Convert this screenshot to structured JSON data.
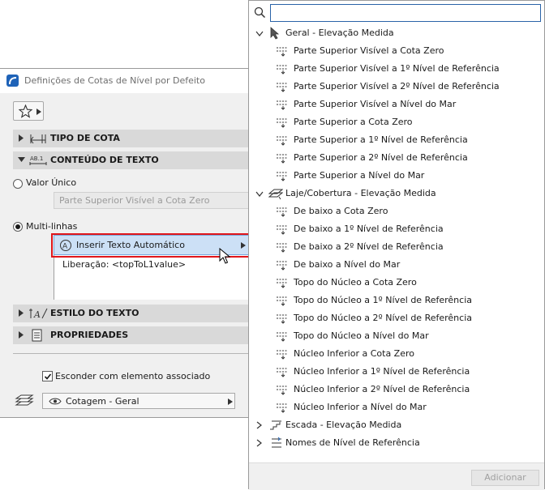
{
  "dialog": {
    "title": "Definições de Cotas de Nível por Defeito",
    "sections": {
      "tipo_de_cota": "TIPO DE COTA",
      "conteudo_de_texto": "CONTEÚDO DE TEXTO",
      "estilo_do_texto": "ESTILO DO TEXTO",
      "propriedades": "PROPRIEDADES"
    },
    "valor_unico_label": "Valor Único",
    "valor_unico_value": "Parte Superior Visível a Cota Zero",
    "multi_linhas_label": "Multi-linhas",
    "auto_text_button": "Inserir Texto Automático",
    "multi_text_content": "Liberação: <topToL1value>",
    "hide_checkbox_label": "Esconder com elemento associado",
    "hide_checked": true,
    "layer_value": "Cotagem - Geral"
  },
  "popup": {
    "search_value": "",
    "groups": [
      {
        "label": "Geral - Elevação Medida",
        "expanded": true,
        "items": [
          "Parte Superior Visível a Cota Zero",
          "Parte Superior Visível a 1º Nível de Referência",
          "Parte Superior Visível a 2º Nível de Referência",
          "Parte Superior Visível a Nível do Mar",
          "Parte Superior a Cota Zero",
          "Parte Superior a 1º Nível de Referência",
          "Parte Superior a 2º Nível de Referência",
          "Parte Superior a Nível do Mar"
        ]
      },
      {
        "label": "Laje/Cobertura - Elevação Medida",
        "expanded": true,
        "items": [
          "De baixo a Cota Zero",
          "De baixo a 1º Nível de Referência",
          "De baixo a 2º Nível de Referência",
          "De baixo a Nível do Mar",
          "Topo do Núcleo a Cota Zero",
          "Topo do Núcleo a 1º Nível de Referência",
          "Topo do Núcleo a 2º Nível de Referência",
          "Topo do Núcleo a Nível do Mar",
          "Núcleo Inferior a Cota Zero",
          "Núcleo Inferior a 1º Nível de Referência",
          "Núcleo Inferior a 2º Nível de Referência",
          "Núcleo Inferior a Nível do Mar"
        ]
      },
      {
        "label": "Escada - Elevação Medida",
        "expanded": false,
        "items": []
      },
      {
        "label": "Nomes de Nível de Referência",
        "expanded": false,
        "items": []
      }
    ],
    "add_button": "Adicionar"
  },
  "colors": {
    "highlight_border": "#e0161b",
    "selected_fill": "#cce0f6",
    "accent_blue": "#1f63b8"
  }
}
